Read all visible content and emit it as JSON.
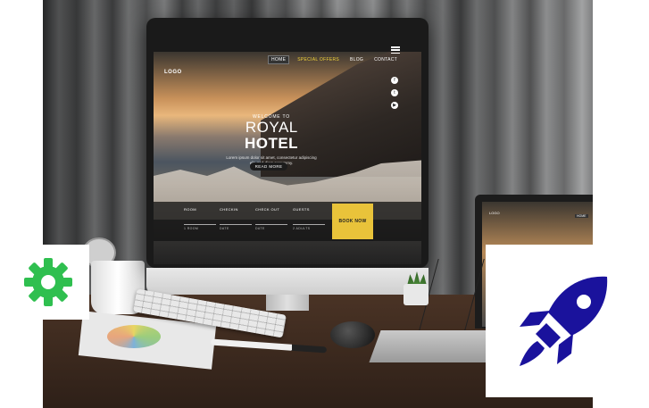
{
  "site": {
    "logo": "LOGO",
    "nav": [
      "HOME",
      "SPECIAL OFFERS",
      "BLOG",
      "CONTACT"
    ],
    "welcome": "WELCOME TO",
    "brand_light": "ROYAL",
    "brand_bold": "HOTEL",
    "lorem": "Lorem ipsum dolor sit amet, consectetur adipiscing elit, sed diam nonummy.",
    "read_more": "READ MORE",
    "booking_fields": [
      {
        "label": "ROOM",
        "sub": "1 ROOM"
      },
      {
        "label": "CHECKIN",
        "sub": "DATE"
      },
      {
        "label": "CHECK OUT",
        "sub": "DATE"
      },
      {
        "label": "GUESTS",
        "sub": "2 ADULTS"
      }
    ],
    "book_now": "BOOK NOW"
  },
  "laptop": {
    "logo": "LOGO",
    "home": "HOME"
  },
  "icons": {
    "gear": {
      "name": "gear-icon",
      "color": "#2fbf4f"
    },
    "rocket": {
      "name": "rocket-icon",
      "color": "#1a129c"
    }
  },
  "colors": {
    "accent_yellow": "#e9c33a",
    "nav_offers": "#f0d23a"
  }
}
